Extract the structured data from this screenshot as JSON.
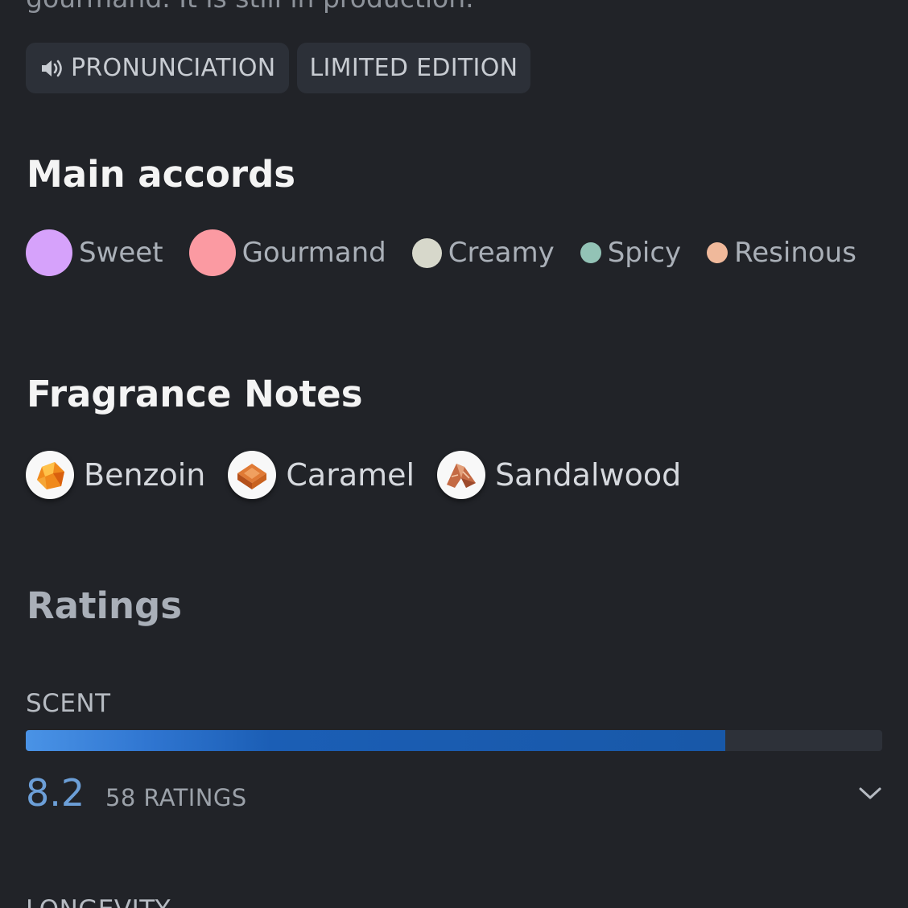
{
  "description_tail": "gourmand. It is still in production.",
  "tags": {
    "pronunciation": "PRONUNCIATION",
    "limited_edition": "LIMITED EDITION"
  },
  "main_accords": {
    "title": "Main accords",
    "items": [
      {
        "label": "Sweet",
        "color": "#d6a2fb"
      },
      {
        "label": "Gourmand",
        "color": "#fb9aa2"
      },
      {
        "label": "Creamy",
        "color": "#d7d8cb"
      },
      {
        "label": "Spicy",
        "color": "#93c3b6"
      },
      {
        "label": "Resinous",
        "color": "#f0b99b"
      }
    ]
  },
  "fragrance_notes": {
    "title": "Fragrance Notes",
    "items": [
      {
        "label": "Benzoin",
        "icon": "benzoin-icon"
      },
      {
        "label": "Caramel",
        "icon": "caramel-icon"
      },
      {
        "label": "Sandalwood",
        "icon": "sandalwood-icon"
      }
    ]
  },
  "ratings": {
    "title": "Ratings",
    "scent": {
      "label": "SCENT",
      "score": "8.2",
      "count_text": "58 RATINGS",
      "fill_fraction": 0.817
    }
  },
  "next_section_label": "LONGEVITY"
}
